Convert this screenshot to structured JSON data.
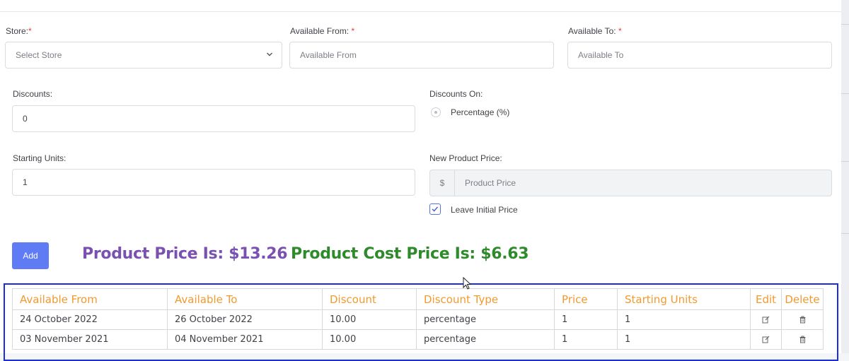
{
  "form": {
    "store": {
      "label": "Store:",
      "required": "*",
      "placeholder": "Select Store"
    },
    "available_from": {
      "label": "Available From: ",
      "required": "*",
      "placeholder": "Available From"
    },
    "available_to": {
      "label": "Available To: ",
      "required": "*",
      "placeholder": "Available To"
    },
    "discounts": {
      "label": "Discounts:",
      "value": "0"
    },
    "discounts_on": {
      "label": "Discounts On:",
      "option": "Percentage (%)"
    },
    "starting_units": {
      "label": "Starting Units:",
      "value": "1"
    },
    "new_product_price": {
      "label": "New Product Price:",
      "prefix": "$",
      "placeholder": "Product Price"
    },
    "leave_initial_price": {
      "label": "Leave Initial Price",
      "checked": true
    }
  },
  "actions": {
    "add_label": "Add"
  },
  "summary": {
    "product_price": "Product Price Is: $13.26",
    "product_cost_price": "Product Cost Price Is: $6.63"
  },
  "table": {
    "headers": [
      "Available From",
      "Available To",
      "Discount",
      "Discount Type",
      "Price",
      "Starting Units",
      "Edit",
      "Delete"
    ],
    "rows": [
      [
        "24 October 2022",
        "26 October 2022",
        "10.00",
        "percentage",
        "1",
        "1"
      ],
      [
        "03 November 2021",
        "04 November 2021",
        "10.00",
        "percentage",
        "1",
        "1"
      ]
    ]
  },
  "colors": {
    "accent": "#5f7cf5",
    "price_purple": "#7a51b0",
    "cost_green": "#2f8a2c",
    "header_orange": "#f29a2e",
    "required_red": "#e03b3b",
    "table_focus": "#1a2ee0"
  },
  "icons": {
    "select_chevron": "chevron-down-icon",
    "edit": "edit-icon",
    "delete": "trash-icon",
    "check": "check-icon",
    "cursor": "mouse-cursor-icon"
  }
}
